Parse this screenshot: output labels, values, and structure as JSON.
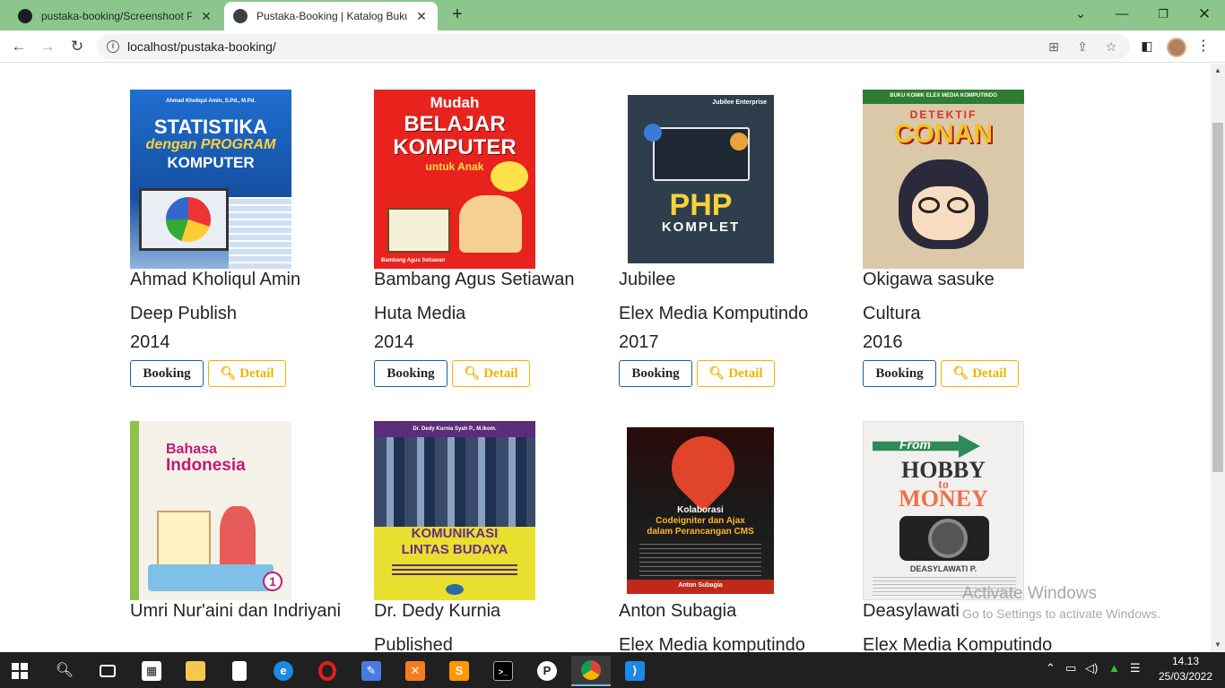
{
  "browser": {
    "tabs": [
      {
        "title": "pustaka-booking/Screenshoot Pr",
        "active": false,
        "icon": "github-icon"
      },
      {
        "title": "Pustaka-Booking | Katalog Buku",
        "active": true,
        "icon": "globe-icon"
      }
    ],
    "url": "localhost/pustaka-booking/"
  },
  "catalog": {
    "books": [
      {
        "author": "Ahmad Kholiqul Amin",
        "publisher": "Deep Publish",
        "year": "2014",
        "cover": {
          "bg": "#1b5db8",
          "top": "Ahmad Kholiqul Amin, S.Pd., M.Pd.",
          "lines": [
            "STATISTIKA",
            "dengan PROGRAM",
            "KOMPUTER"
          ]
        }
      },
      {
        "author": "Bambang Agus Setiawan",
        "publisher": "Huta Media",
        "year": "2014",
        "cover": {
          "bg": "#e8231e",
          "top": "Mudah",
          "lines": [
            "BELAJAR",
            "KOMPUTER",
            "untuk Anak"
          ],
          "bottom": "Bambang Agus Setiawan"
        }
      },
      {
        "author": "Jubilee",
        "publisher": "Elex Media Komputindo",
        "year": "2017",
        "cover": {
          "bg": "#2f3e4c",
          "top": "Jubilee Enterprise",
          "lines": [
            "PHP",
            "KOMPLET"
          ]
        }
      },
      {
        "author": "Okigawa sasuke",
        "publisher": "Cultura",
        "year": "2016",
        "cover": {
          "bg": "#d9c9a8",
          "top": "BUKU KOMIK ELEX MEDIA KOMPUTINDO",
          "lines": [
            "DETEKTIF",
            "CONAN"
          ]
        }
      },
      {
        "author": "Umri Nur'aini dan Indriyani",
        "publisher": "",
        "year": "",
        "cover": {
          "bg": "#f4f1e8",
          "lines": [
            "Bahasa",
            "Indonesia"
          ]
        }
      },
      {
        "author": "Dr. Dedy Kurnia",
        "publisher": "Published",
        "year": "",
        "cover": {
          "bg": "#e8df2e",
          "top": "Dr. Dedy Kurnia Syah P., M.Ikom.",
          "lines": [
            "KOMUNIKASI",
            "LINTAS BUDAYA"
          ]
        }
      },
      {
        "author": "Anton Subagia",
        "publisher": "Elex Media komputindo",
        "year": "",
        "cover": {
          "bg": "#7a1414",
          "lines": [
            "Kolaborasi",
            "Codeigniter dan Ajax",
            "dalam Perancangan CMS"
          ],
          "bottom": "Anton Subagia"
        }
      },
      {
        "author": "Deasylawati",
        "publisher": "Elex Media Komputindo",
        "year": "",
        "cover": {
          "bg": "#f2f0ee",
          "lines": [
            "From",
            "HOBBY",
            "to",
            "MONEY"
          ],
          "bottom": "DEASYLAWATI P."
        }
      }
    ],
    "booking_label": "Booking",
    "detail_label": "Detail"
  },
  "watermark": {
    "title": "Activate Windows",
    "subtitle": "Go to Settings to activate Windows."
  },
  "taskbar": {
    "time": "14.13",
    "date": "25/03/2022"
  },
  "colors": {
    "chrome_green": "#8cc68c",
    "booking_border": "#1a5fa8",
    "detail_accent": "#f0b400"
  }
}
